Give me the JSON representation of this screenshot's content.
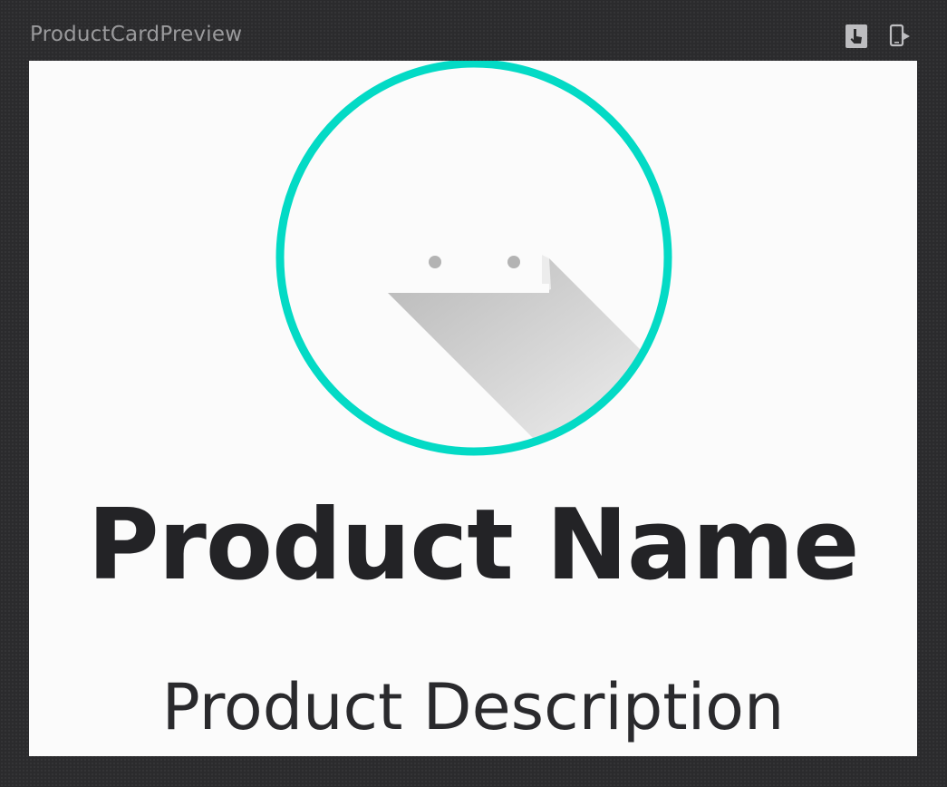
{
  "preview": {
    "title": "ProductCardPreview"
  },
  "toolbar": {
    "interactive_icon": "interactive-mode-icon",
    "deploy_icon": "deploy-to-device-icon"
  },
  "card": {
    "image_icon": "android-logo-image",
    "name": "Product Name",
    "description": "Product Description"
  },
  "colors": {
    "accent": "#03dac5",
    "text": "#232326",
    "canvas": "#fbfbfb"
  }
}
